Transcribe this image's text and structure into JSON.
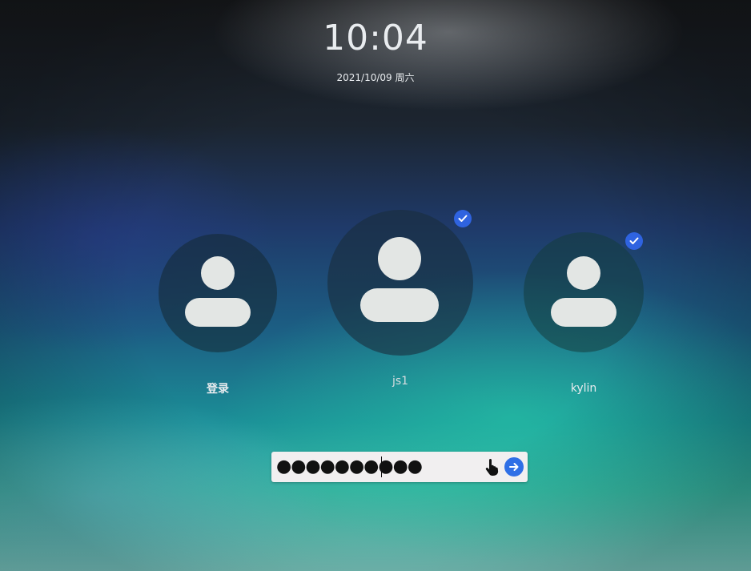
{
  "clock": {
    "time": "10:04",
    "date": "2021/10/09 周六"
  },
  "users": [
    {
      "name": "登录",
      "selected": false
    },
    {
      "name": "js1",
      "selected": true
    },
    {
      "name": "kylin",
      "selected": true
    }
  ],
  "password": {
    "masked_value": "●●●●●●●●●●"
  },
  "icons": {
    "avatar": "user-avatar-icon",
    "selected": "checkmark-icon",
    "pointer": "hand-pointer-icon",
    "submit": "arrow-right-icon"
  },
  "colors": {
    "accent": "#2f6fe6",
    "avatar_fill": "#e3e6e4",
    "text": "#e9ecef"
  }
}
